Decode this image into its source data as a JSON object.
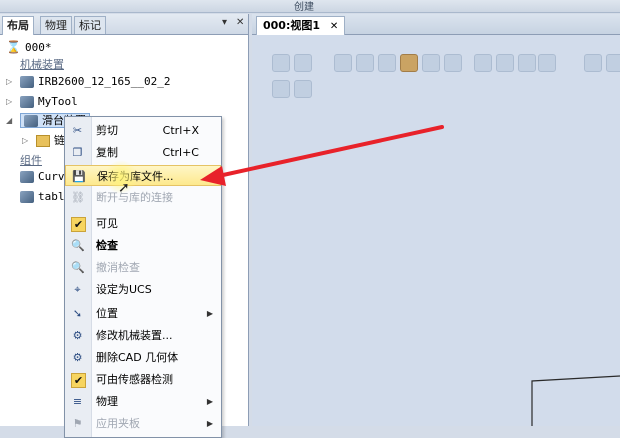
{
  "ribbon": {
    "group_label": "创建"
  },
  "left_panel": {
    "tabs": [
      "布局",
      "物理",
      "标记"
    ],
    "controls": {
      "pin": "▾",
      "close": "✕"
    },
    "tree": {
      "station": "000*",
      "group_mechanisms": "机械装置",
      "mech1": "IRB2600_12_165__02_2",
      "mech2": "MyTool",
      "mech3": "滑台装置",
      "mech3_child": "链",
      "group_components": "组件",
      "comp1": "Curv",
      "comp2": "tabl"
    }
  },
  "viewport": {
    "tab_label": "000:视图1",
    "tab_close": "✕"
  },
  "context_menu": {
    "items": [
      {
        "label": "剪切",
        "shortcut": "Ctrl+X",
        "icon": "✂"
      },
      {
        "label": "复制",
        "shortcut": "Ctrl+C",
        "icon": "❐"
      },
      {
        "label": "保存为库文件...",
        "icon": "💾"
      },
      {
        "label": "断开与库的连接",
        "icon": "⛓"
      },
      {
        "label": "可见",
        "icon": "✔"
      },
      {
        "label": "检查",
        "icon": "🔍"
      },
      {
        "label": "撤消检查",
        "icon": "🔍"
      },
      {
        "label": "设定为UCS",
        "icon": "⌖"
      },
      {
        "label": "位置",
        "icon": "➘",
        "arrow": "▶"
      },
      {
        "label": "修改机械装置...",
        "icon": "⚙"
      },
      {
        "label": "删除CAD 几何体",
        "icon": "⚙"
      },
      {
        "label": "可由传感器检测",
        "icon": "✔"
      },
      {
        "label": "物理",
        "icon": "≡",
        "arrow": "▶"
      },
      {
        "label": "应用夹板",
        "icon": "⚑",
        "arrow": "▶"
      }
    ]
  },
  "colors": {
    "arrow": "#e8222a",
    "hover": "#fde98d",
    "selection": "#cfe1f7"
  }
}
